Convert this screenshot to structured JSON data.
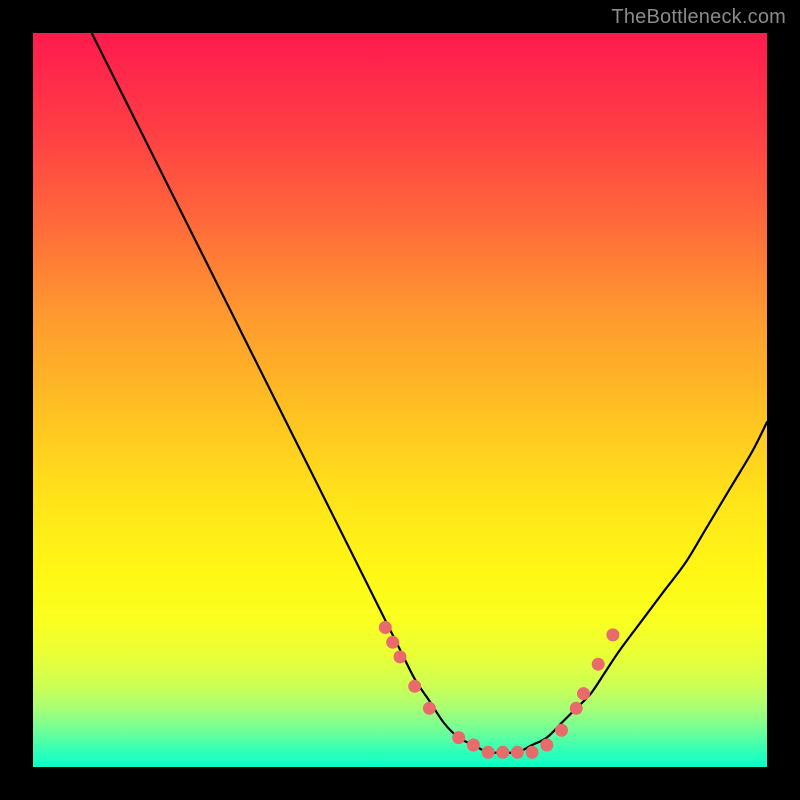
{
  "watermark": "TheBottleneck.com",
  "colors": {
    "page_bg": "#000000",
    "curve_stroke": "#000000",
    "marker_fill": "#e86a6a",
    "marker_stroke": "#c94f4f",
    "watermark_text": "#8a8a8a"
  },
  "chart_data": {
    "type": "line",
    "title": "",
    "xlabel": "",
    "ylabel": "",
    "xlim": [
      0,
      100
    ],
    "ylim": [
      0,
      100
    ],
    "grid": false,
    "legend": false,
    "series": [
      {
        "name": "bottleneck-curve",
        "x": [
          8,
          10,
          12,
          15,
          18,
          21,
          24,
          27,
          30,
          33,
          36,
          39,
          42,
          44,
          46,
          48,
          50,
          52,
          54,
          56,
          58,
          60,
          62,
          64,
          66,
          68,
          70,
          72,
          74,
          76,
          78,
          80,
          83,
          86,
          89,
          92,
          95,
          98,
          100
        ],
        "values": [
          100,
          96,
          92,
          86,
          80,
          74,
          68,
          62,
          56,
          50,
          44,
          38,
          32,
          28,
          24,
          20,
          16,
          12,
          9,
          6,
          4,
          3,
          2,
          2,
          2,
          3,
          4,
          6,
          8,
          10,
          13,
          16,
          20,
          24,
          28,
          33,
          38,
          43,
          47
        ]
      }
    ],
    "markers": {
      "name": "highlight-points",
      "x": [
        48,
        49,
        50,
        52,
        54,
        58,
        60,
        62,
        64,
        66,
        68,
        70,
        72,
        74,
        75,
        77,
        79
      ],
      "values": [
        19,
        17,
        15,
        11,
        8,
        4,
        3,
        2,
        2,
        2,
        2,
        3,
        5,
        8,
        10,
        14,
        18
      ]
    },
    "annotations": []
  }
}
